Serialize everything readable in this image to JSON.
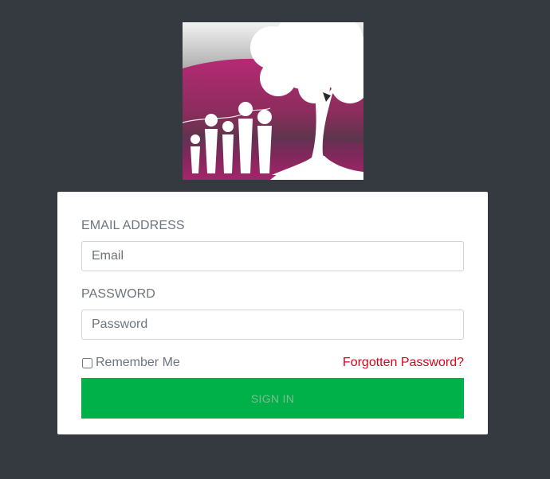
{
  "colors": {
    "background": "#343a40",
    "card": "#ffffff",
    "accent_link": "#e3001b",
    "button": "#00b14a",
    "logo_magenta": "#a0205f"
  },
  "logo": {
    "icon": "family-tree-logo-icon"
  },
  "login_form": {
    "email_label": "EMAIL ADDRESS",
    "email_placeholder": "Email",
    "email_value": "",
    "password_label": "PASSWORD",
    "password_placeholder": "Password",
    "password_value": "",
    "remember_label": "Remember Me",
    "remember_checked": false,
    "forgot_label": "Forgotten Password?",
    "signin_label": "SIGN IN"
  }
}
